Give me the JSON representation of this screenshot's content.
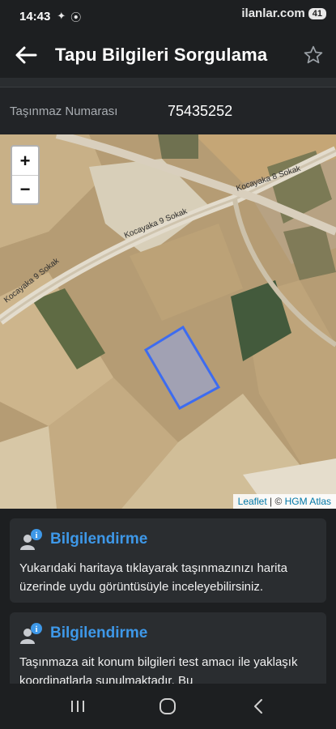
{
  "status": {
    "time": "14:43",
    "icons": [
      "signal-icon",
      "bluetooth-icon"
    ],
    "brand": "ilanlar.com",
    "battery": "41"
  },
  "header": {
    "title": "Tapu Bilgileri Sorgulama",
    "back_icon": "arrow-left-icon",
    "favorite_icon": "star-outline-icon"
  },
  "field": {
    "label": "Taşınmaz Numarası",
    "value": "75435252"
  },
  "map": {
    "zoom_in": "+",
    "zoom_out": "−",
    "attribution_leaflet": "Leaflet",
    "attribution_sep": " | © ",
    "attribution_hgm": "HGM Atlas",
    "roads": [
      "Kocayaka 9 Sokak",
      "Kocayaka 8 Sokak",
      "Kocayaka 9 Sokak"
    ],
    "parcel_color": "#3d6cf0"
  },
  "cards": [
    {
      "title": "Bilgilendirme",
      "text": "Yukarıdaki haritaya tıklayarak taşınmazınızı harita üzerinde uydu görüntüsüyle inceleyebilirsiniz."
    },
    {
      "title": "Bilgilendirme",
      "text": "Taşınmaza ait konum bilgileri test amacı ile yaklaşık koordinatlarla sunulmaktadır. Bu"
    }
  ],
  "nav": {
    "recents_icon": "recent-apps-icon",
    "home_icon": "home-icon",
    "back_icon": "back-chevron-icon"
  },
  "colors": {
    "background": "#1d1f21",
    "accent": "#3e98e8"
  }
}
